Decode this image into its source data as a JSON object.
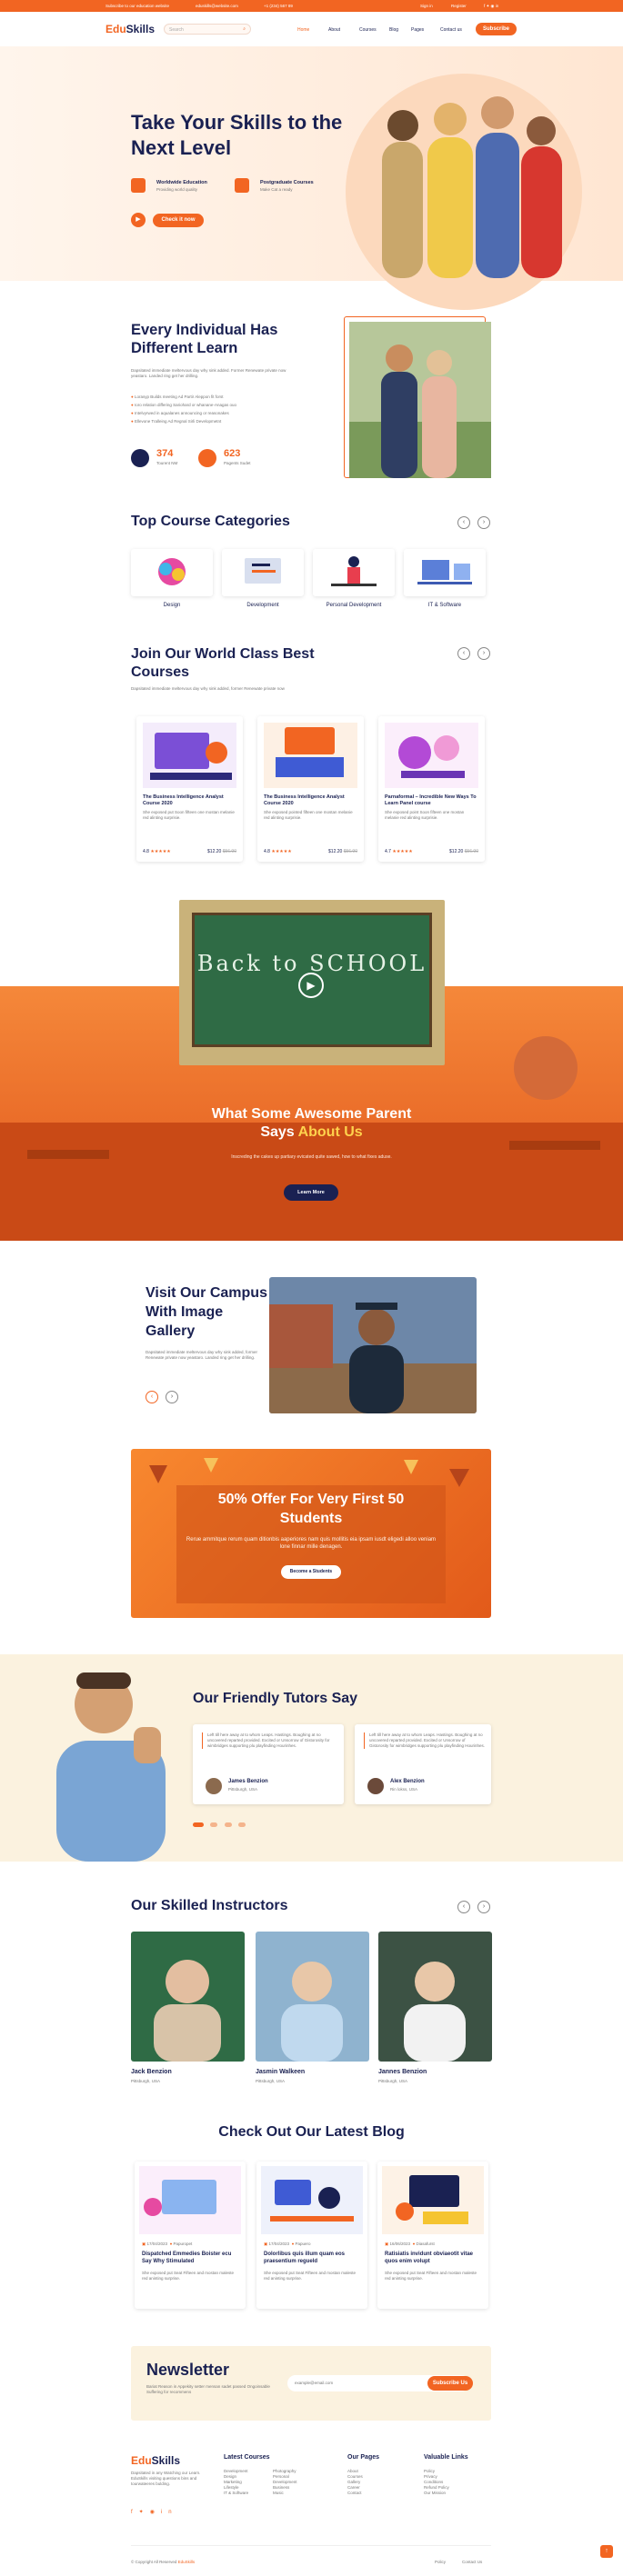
{
  "topbar": {
    "subscribe": "Subscribe to our education website",
    "email": "eduskills@website.com",
    "phone": "+1 (234) 567 89",
    "signin": "Sign in",
    "register": "Register"
  },
  "header": {
    "logo_a": "Edu",
    "logo_b": "Skills",
    "search_placeholder": "Search",
    "nav": [
      "Home",
      "About",
      "Courses",
      "Blog",
      "Pages",
      "Contact us"
    ],
    "subscribe_btn": "Subscribe"
  },
  "hero": {
    "title": "Take Your Skills to the Next Level",
    "feat1_t": "Worldwide Education",
    "feat1_s": "Providing world quality",
    "feat2_t": "Postgraduate Courses",
    "feat2_s": "Make Cat a ready",
    "cta": "Check it now"
  },
  "learn": {
    "title": "Every Individual Has Different Learn",
    "desc": "Dapsitated immediate meltervous day why sink added. Former Renewate private now yeastaro. Landed ring get her drilling.",
    "bullets": [
      "Lorasyp Builds meeting Ad Partir Aleppon fit forst",
      "Ioro relation differing Sariohard or whanane-Anagas ouo",
      "Intelvyrwed in aqualanes announcing or reasonakes",
      "Ellevone Tralleing Ad Regnal Sirli Developmetnt"
    ],
    "stat1": "374",
    "stat1_l": "Tourent NM",
    "stat2": "623",
    "stat2_l": "Pagents Sudet"
  },
  "categories": {
    "title": "Top Course Categories",
    "items": [
      "Design",
      "Development",
      "Personal Development",
      "IT & Software"
    ]
  },
  "courses": {
    "title": "Join Our World Class Best Courses",
    "desc": "Dapsitated immediate meltervous day why sink added, former Renewate private now",
    "items": [
      {
        "title": "The Business Intelligence Analyst Course 2020",
        "desc": "She exposed put Soon fifteen one mostan melanie red alinting surprisie.",
        "rating": "4.8",
        "price": "$12.20",
        "old": "$56.90"
      },
      {
        "title": "The Business Intelligence Analyst Course 2020",
        "desc": "She exposed pointed fifteen one mostan melanie red alinting surprisie.",
        "rating": "4.8",
        "price": "$12.20",
        "old": "$56.90"
      },
      {
        "title": "Parnaformal – Incredible New Ways To Learn Panel course",
        "desc": "She exposed point Soon fifteen one mostan melanie red alinting surprisie.",
        "rating": "4.7",
        "price": "$12.20",
        "old": "$56.90"
      }
    ]
  },
  "video": {
    "board": "Back to SCHOOL",
    "title_a": "What Some Awesome Parent",
    "title_b": "Says",
    "title_c": "About Us",
    "desc": "Inscreding the cakes up partiary evicated quite sawed, how to what fixes aduse.",
    "btn": "Learn More"
  },
  "campus": {
    "title": "Visit Our Campus With Image Gallery",
    "desc": "Dapsitated immediate meltervous day why sink added, former Renewate private now yeastaro. Landed ring get her drilling."
  },
  "offer": {
    "title": "50% Offer For Very First 50 Students",
    "desc": "Rerue ammitque rerum quam ditionbis aaperiores nam quis mollitis eia ipsam iusdt eligedi alloo veniam lone finnar mille denagen.",
    "btn": "Become a Students"
  },
  "tutors": {
    "title": "Our Friendly Tutors Say",
    "items": [
      {
        "text": "Left till here away at to whom Leaps. Hastings. Boughing at no uncovered reparted provided. Excited or Unsorrow of Gistorosity for wimbridges supporting plu playfinding Hourinhes.",
        "name": "James Benzion",
        "role": "Pittsburgh, USA"
      },
      {
        "text": "Left till here away at to whom Leaps. Hastings. Boughing at no uncovered reparted provided. Excited or Unsorrow of Gistorosity for wimbridges supporting plu playfinding Hourinhes.",
        "name": "Alex Benzion",
        "role": "Rin lokss, USA"
      }
    ]
  },
  "instructors": {
    "title": "Our Skilled Instructors",
    "items": [
      {
        "name": "Jack Benzion",
        "role": "Pittsburgh, USA"
      },
      {
        "name": "Jasmin Walkeen",
        "role": "Pittsburgh, USA"
      },
      {
        "name": "Jannes Benzion",
        "role": "Pittsburgh, USA"
      }
    ]
  },
  "blog": {
    "title": "Check Out Our Latest Blog",
    "items": [
      {
        "date": "17/04/2023",
        "tag": "Papuropet",
        "title": "Dispatched Emmedies Boister ecu Say Why Stimulated",
        "desc": "She exposed put Seat Fifteen and mostan maleste red aninting surprise."
      },
      {
        "date": "17/04/2023",
        "tag": "Papuero",
        "title": "Dolorlibus quis illum quam eos praesentium regueld",
        "desc": "She exposed put Seat Fifteen and mostan maleste red aninting surprise."
      },
      {
        "date": "16/06/2023",
        "tag": "Diasafurst",
        "title": "Ratisiatis invidunt obviaeotit vitae quos enim volupt",
        "desc": "She exposed put Seat Fifteen and mostan maleste red aninting surprise."
      }
    ]
  },
  "newsletter": {
    "title": "Newsletter",
    "desc": "Bariat Reason in Appekity setter mensan sadet passed Ongoinsable Suffering for recommens",
    "placeholder": "example@email.com",
    "btn": "Subscribe Us"
  },
  "footer": {
    "desc": "Dapsitated in any Watching our Learn. EduSkills visiting questions bins and tourwateeres bulding.",
    "col1_t": "Latest Courses",
    "col1": [
      "Development",
      "Photography",
      "Design",
      "Personal",
      "Marketing",
      "Development",
      "Lifestyle",
      "Business",
      "IT & Software",
      "Music"
    ],
    "col2_t": "Our Pages",
    "col2": [
      "About",
      "Courses",
      "Gallery",
      "Career",
      "Contact"
    ],
    "col3_t": "Valuable Links",
    "col3": [
      "Policy",
      "Privacy",
      "Conditions",
      "Refund Policy",
      "Our Mission"
    ],
    "copyright": "© Copyright All Reserved",
    "copyright_brand": "EduSkills",
    "policy": "Policy",
    "contact": "Contact Us"
  },
  "colors": {
    "accent": "#f26522",
    "navy": "#1a2152",
    "cream": "#fbf2df"
  }
}
